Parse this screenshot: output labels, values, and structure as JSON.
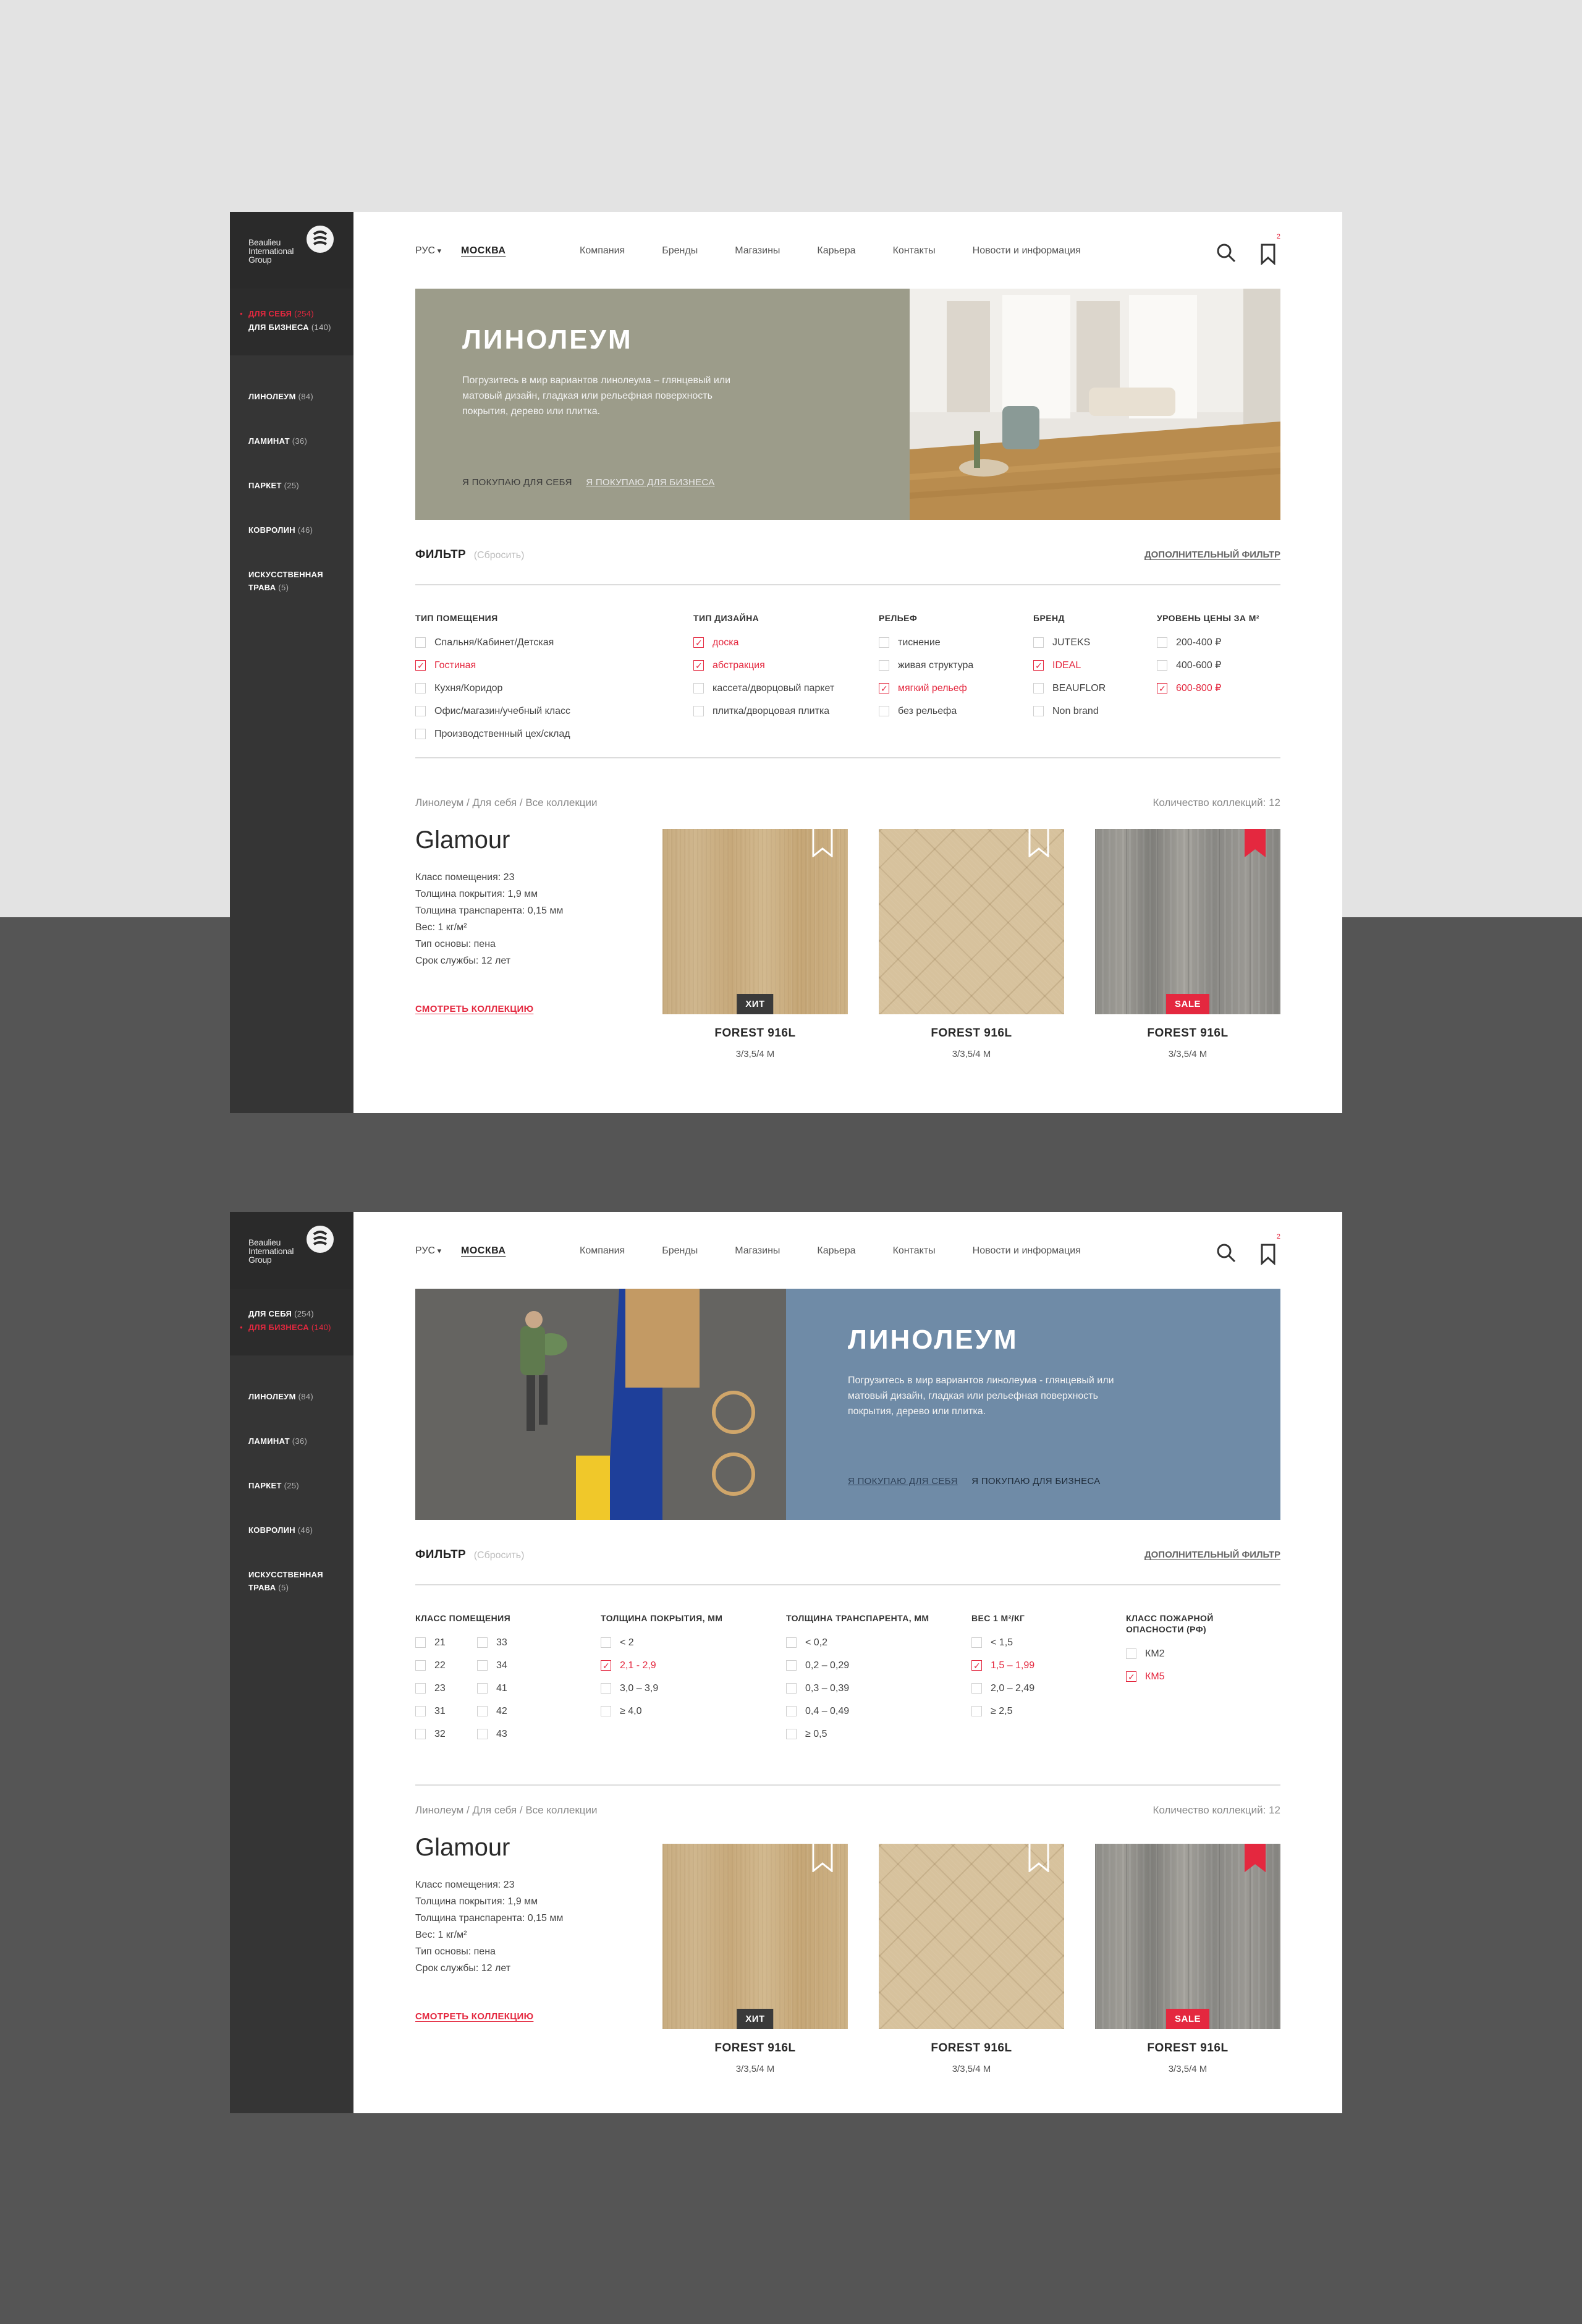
{
  "brand": {
    "logo_text": "Beaulieu International Group"
  },
  "colors": {
    "accent": "#e4283f",
    "sidebar": "#353535",
    "hero_green": "#9c9c8a",
    "hero_blue": "#6f8ba7"
  },
  "header": {
    "lang": "РУС",
    "city": "МОСКВА",
    "nav": [
      "Компания",
      "Бренды",
      "Магазины",
      "Карьера",
      "Контакты",
      "Новости и информация"
    ],
    "bookmark_count": "2"
  },
  "sidebar": {
    "audience": [
      {
        "label": "ДЛЯ СЕБЯ",
        "count": "(254)"
      },
      {
        "label": "ДЛЯ БИЗНЕСА",
        "count": "(140)"
      }
    ],
    "categories": [
      {
        "label": "ЛИНОЛЕУМ",
        "count": "(84)"
      },
      {
        "label": "ЛАМИНАТ",
        "count": "(36)"
      },
      {
        "label": "ПАРКЕТ",
        "count": "(25)"
      },
      {
        "label": "КОВРОЛИН",
        "count": "(46)"
      },
      {
        "label": "ИСКУССТВЕННАЯ ТРАВА",
        "count": "(5)"
      }
    ]
  },
  "hero": {
    "title": "ЛИНОЛЕУМ",
    "desc1": "Погрузитесь в мир вариантов линолеума – глянцевый или матовый дизайн, гладкая или рельефная поверхность покрытия, дерево или плитка.",
    "desc2": "Погрузитесь в мир вариантов линолеума - глянцевый или матовый дизайн, гладкая или рельефная поверхность покрытия, дерево или плитка.",
    "link_self": "Я ПОКУПАЮ ДЛЯ СЕБЯ",
    "link_business": "Я ПОКУПАЮ ДЛЯ БИЗНЕСА"
  },
  "filter": {
    "title": "ФИЛЬТР",
    "reset": "(Сбросить)",
    "more": "ДОПОЛНИТЕЛЬНЫЙ ФИЛЬТР"
  },
  "filters_self": {
    "room": {
      "title": "ТИП ПОМЕЩЕНИЯ",
      "options": [
        "Спальня/Кабинет/Детская",
        "Гостиная",
        "Кухня/Коридор",
        "Офис/магазин/учебный класс",
        "Производственный цех/склад"
      ],
      "checked": [
        1
      ]
    },
    "design": {
      "title": "ТИП ДИЗАЙНА",
      "options": [
        "доска",
        "абстракция",
        "кассета/дворцовый паркет",
        "плитка/дворцовая плитка"
      ],
      "checked": [
        0,
        1
      ]
    },
    "relief": {
      "title": "РЕЛЬЕФ",
      "options": [
        "тиснение",
        "живая структура",
        "мягкий рельеф",
        "без рельефа"
      ],
      "checked": [
        2
      ]
    },
    "brand": {
      "title": "БРЕНД",
      "options": [
        "JUTEKS",
        "IDEAL",
        "BEAUFLOR",
        "Non brand"
      ],
      "checked": [
        1
      ]
    },
    "price": {
      "title": "УРОВЕНЬ ЦЕНЫ ЗА М²",
      "options": [
        "200-400 ₽",
        "400-600 ₽",
        "600-800 ₽"
      ],
      "checked": [
        2
      ]
    }
  },
  "filters_business": {
    "room_class": {
      "title": "КЛАСС ПОМЕЩЕНИЯ",
      "options": [
        "21",
        "33",
        "22",
        "34",
        "23",
        "41",
        "31",
        "42",
        "32",
        "43"
      ]
    },
    "thickness": {
      "title": "ТОЛЩИНА ПОКРЫТИЯ, ММ",
      "options": [
        "< 2",
        "2,1 - 2,9",
        "3,0 – 3,9",
        "≥ 4,0"
      ],
      "checked": [
        1
      ]
    },
    "transparent": {
      "title": "ТОЛЩИНА ТРАНСПАРЕНТА, ММ",
      "options": [
        "< 0,2",
        "0,2 – 0,29",
        "0,3 – 0,39",
        "0,4 – 0,49",
        "≥ 0,5"
      ]
    },
    "weight": {
      "title": "ВЕС 1 М²/КГ",
      "options": [
        "< 1,5",
        "1,5 – 1,99",
        "2,0 – 2,49",
        "≥ 2,5"
      ],
      "checked": [
        1
      ]
    },
    "fire": {
      "title": "КЛАСС ПОЖАРНОЙ ОПАСНОСТИ (РФ)",
      "options": [
        "КМ2",
        "КМ5"
      ],
      "checked": [
        1
      ]
    }
  },
  "listing": {
    "breadcrumb": "Линолеум / Для себя / Все коллекции",
    "count": "Количество коллекций: 12",
    "collection": {
      "name": "Glamour",
      "specs": [
        "Класс помещения: 23",
        "Толщина покрытия: 1,9 мм",
        "Толщина транспарента: 0,15 мм",
        "Вес: 1 кг/м²",
        "Тип основы: пена",
        "Срок службы: 12 лет"
      ],
      "link": "СМОТРЕТЬ КОЛЛЕКЦИЮ"
    },
    "products": [
      {
        "name": "FOREST 916L",
        "size": "3/3,5/4 М",
        "tag": "ХИТ",
        "bookmarked": false
      },
      {
        "name": "FOREST 916L",
        "size": "3/3,5/4 М",
        "tag": "",
        "bookmarked": false
      },
      {
        "name": "FOREST 916L",
        "size": "3/3,5/4 М",
        "tag": "SALE",
        "bookmarked": true
      }
    ]
  }
}
